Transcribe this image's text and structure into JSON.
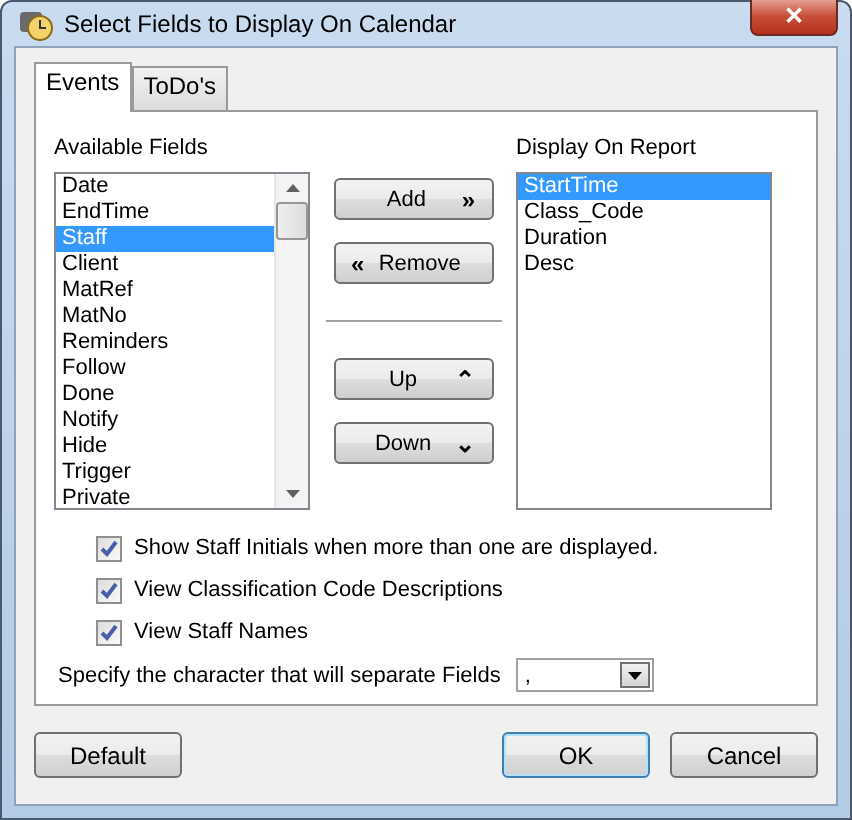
{
  "window": {
    "title": "Select Fields to Display On Calendar",
    "close": "✕"
  },
  "tabs": [
    {
      "label": "Events",
      "selected": true
    },
    {
      "label": "ToDo's",
      "selected": false
    }
  ],
  "available_fields": {
    "label": "Available Fields",
    "items": [
      {
        "label": "Date",
        "selected": false
      },
      {
        "label": "EndTime",
        "selected": false
      },
      {
        "label": "Staff",
        "selected": true
      },
      {
        "label": "Client",
        "selected": false
      },
      {
        "label": "MatRef",
        "selected": false
      },
      {
        "label": "MatNo",
        "selected": false
      },
      {
        "label": "Reminders",
        "selected": false
      },
      {
        "label": "Follow",
        "selected": false
      },
      {
        "label": "Done",
        "selected": false
      },
      {
        "label": "Notify",
        "selected": false
      },
      {
        "label": "Hide",
        "selected": false
      },
      {
        "label": "Trigger",
        "selected": false
      },
      {
        "label": "Private",
        "selected": false
      }
    ]
  },
  "move_buttons": [
    {
      "label": "Add",
      "glyph": "»",
      "kind": "trailing"
    },
    {
      "label": "Remove",
      "glyph": "«",
      "kind": "leading"
    }
  ],
  "order_buttons": [
    {
      "label": "Up",
      "glyph": "⌃",
      "kind": "trailing"
    },
    {
      "label": "Down",
      "glyph": "⌄",
      "kind": "trailing"
    }
  ],
  "display_on_report": {
    "label": "Display On Report",
    "items": [
      {
        "label": "StartTime",
        "selected": true
      },
      {
        "label": "Class_Code",
        "selected": false
      },
      {
        "label": "Duration",
        "selected": false
      },
      {
        "label": "Desc",
        "selected": false
      }
    ]
  },
  "options": [
    {
      "label": "Show Staff Initials when more than one are displayed.",
      "checked": true
    },
    {
      "label": "View Classification Code Descriptions",
      "checked": true
    },
    {
      "label": "View Staff Names",
      "checked": true
    }
  ],
  "separator": {
    "label": "Specify the character that will separate Fields",
    "value": ","
  },
  "buttons": [
    {
      "label": "Default",
      "default": false
    },
    {
      "label": "OK",
      "default": true
    },
    {
      "label": "Cancel",
      "default": false
    }
  ]
}
